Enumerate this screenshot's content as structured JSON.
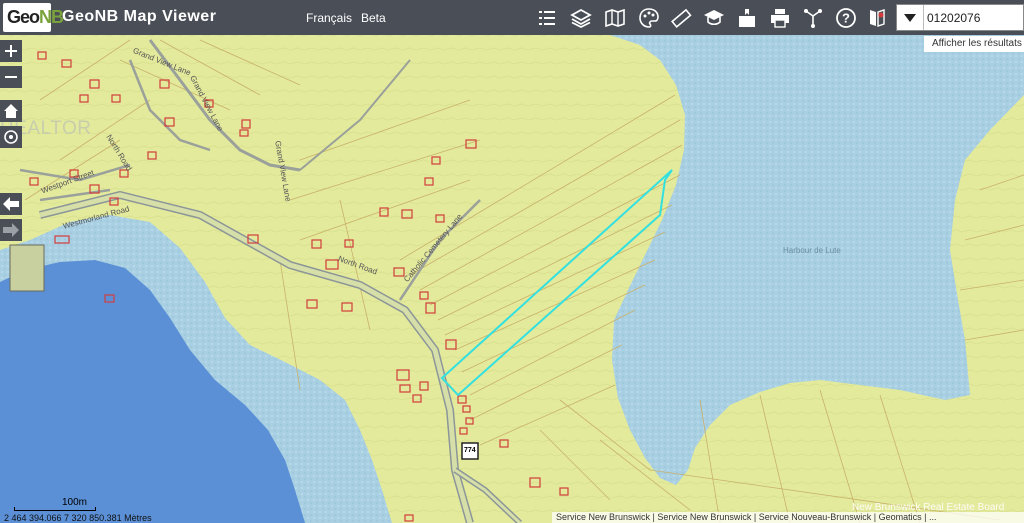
{
  "header": {
    "logo_geo": "Geo",
    "logo_nb": "NB",
    "title": "GeoNB Map Viewer",
    "language_link": "Français",
    "beta_link": "Beta"
  },
  "toolbar": {
    "icons": [
      "list-icon",
      "layers-icon",
      "basemap-icon",
      "palette-icon",
      "measure-icon",
      "education-icon",
      "bookmark-icon",
      "print-icon",
      "share-icon",
      "help-icon",
      "location-icon"
    ]
  },
  "search": {
    "value": "01202076",
    "results_link": "Afficher les résultats"
  },
  "map": {
    "watermark": "REALTOR",
    "street_labels": [
      "Grand View Lane",
      "Grand View Lane",
      "North Road",
      "North Road",
      "Catholic Cemetery Lane",
      "Westmorland Road",
      "Westport Street",
      "Grand View Lane"
    ],
    "water_label": "Harbour de Lute",
    "route_number": "774",
    "highlight_color": "#33e0e0"
  },
  "footer": {
    "scale_label": "100m",
    "coordinates": "2 464 394.066 7 320 850.381 Mètres",
    "attribution": "Service New Brunswick | Service New Brunswick | Service Nouveau-Brunswick | Geomatics | ...",
    "board_watermark": "New Brunswick Real Estate Board"
  }
}
